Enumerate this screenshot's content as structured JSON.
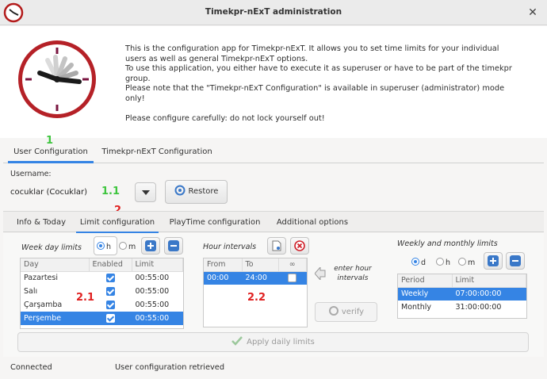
{
  "window": {
    "title": "Timekpr-nExT administration",
    "close_glyph": "✕"
  },
  "intro": [
    "This is the configuration app for Timekpr-nExT. It allows you to set time limits for your individual",
    "users as well as general Timekpr-nExT options.",
    "To use this application, you either have to execute it as superuser or have to be part of the timekpr",
    "group.",
    "Please note that the \"Timekpr-nExT Configuration\" is available in superuser (administrator) mode",
    "only!",
    "",
    "Please configure carefully: do not lock yourself out!"
  ],
  "annotations": {
    "a1": "1",
    "a11": "1.1",
    "a2": "2",
    "a21": "2.1",
    "a22": "2.2"
  },
  "main_tabs": [
    "User Configuration",
    "Timekpr-nExT Configuration"
  ],
  "user": {
    "label": "Username:",
    "value": "cocuklar (Cocuklar)",
    "restore_label": "Restore"
  },
  "sub_tabs": [
    "Info & Today",
    "Limit configuration",
    "PlayTime configuration",
    "Additional options"
  ],
  "weekday": {
    "title": "Week day limits",
    "radio_h": "h",
    "radio_m": "m",
    "columns": [
      "Day",
      "Enabled",
      "Limit"
    ],
    "rows": [
      {
        "day": "Pazartesi",
        "limit": "00:55:00"
      },
      {
        "day": "Salı",
        "limit": "00:55:00"
      },
      {
        "day": "Çarşamba",
        "limit": "00:55:00"
      },
      {
        "day": "Perşembe",
        "limit": "00:55:00"
      }
    ]
  },
  "hours": {
    "title": "Hour intervals",
    "columns": [
      "From",
      "To",
      "∞"
    ],
    "rows": [
      {
        "from": "00:00",
        "to": "24:00"
      }
    ],
    "hint_line1": "enter hour",
    "hint_line2": "intervals",
    "verify_label": "verify"
  },
  "weekly": {
    "title": "Weekly and monthly limits",
    "radio_d": "d",
    "radio_h": "h",
    "radio_m": "m",
    "columns": [
      "Period",
      "Limit"
    ],
    "rows": [
      {
        "period": "Weekly",
        "limit": "07:00:00:00"
      },
      {
        "period": "Monthly",
        "limit": "31:00:00:00"
      }
    ]
  },
  "apply_label": "Apply daily limits",
  "status": {
    "left": "Connected",
    "right": "User configuration retrieved"
  },
  "colors": {
    "accent": "#3584e4",
    "annot_green": "#3ec53e",
    "annot_red": "#e02020"
  }
}
